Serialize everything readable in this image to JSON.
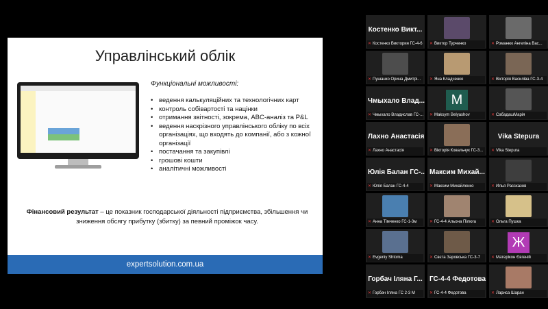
{
  "slide": {
    "title": "Управлінський облік",
    "subtitle": "Функціональні можливості:",
    "bullets": [
      "ведення калькуляційних та технологічних карт",
      "контроль собівартості та націнки",
      "отримання звітності, зокрема, ABC-аналіз та P&L",
      "ведення наскрізного управлінського обліку по всіх організаціях, що входять до компанії, або з кожної організації",
      "постачання та закупівлі",
      "грошові кошти",
      "аналітичні можливості"
    ],
    "financial_term": "Фінансовий результат",
    "financial_text": " – це показник господарської діяльності підприємства, збільшення чи зниження обсягу прибутку (збитку) за певний проміжок часу.",
    "footer": "expertsolution.com.ua"
  },
  "participants": [
    {
      "big_name": "Костенко Викт...",
      "label": "Костенко Виктория ГС-4-6",
      "avatar": null
    },
    {
      "big_name": "",
      "label": "Виктор Турченко",
      "avatar": {
        "type": "photo",
        "color": "#5b4a6a"
      }
    },
    {
      "big_name": "",
      "label": "Романюк Ангеліна Вас...",
      "avatar": {
        "type": "photo",
        "color": "#6a6a6a"
      }
    },
    {
      "big_name": "",
      "label": "Пушанко Орина Дмитрі...",
      "avatar": {
        "type": "photo",
        "color": "#4d4d4d"
      }
    },
    {
      "big_name": "",
      "label": "Яна Кладченко",
      "avatar": {
        "type": "photo",
        "color": "#b89a72"
      }
    },
    {
      "big_name": "",
      "label": "Вікторія Василіва ГС-3-4",
      "avatar": {
        "type": "photo",
        "color": "#7a6655"
      }
    },
    {
      "big_name": "Чмыхало Влад...",
      "label": "Чмыхало Владислав ГС-...",
      "avatar": null
    },
    {
      "big_name": "",
      "label": "Maksym Belyashov",
      "avatar": {
        "type": "letter",
        "letter": "M",
        "color": "#1f5c4f"
      }
    },
    {
      "big_name": "",
      "label": "СабадашМарія",
      "avatar": {
        "type": "photo",
        "color": "#555555"
      }
    },
    {
      "big_name": "Лахно Анастасія",
      "label": "Лахно Анастасія",
      "avatar": null
    },
    {
      "big_name": "",
      "label": "Вікторія Ковальчук ГС-3...",
      "avatar": {
        "type": "photo",
        "color": "#8a6e58"
      }
    },
    {
      "big_name": "Vika Stepura",
      "label": "Vika Stepura",
      "avatar": null
    },
    {
      "big_name": "Юлія Балан ГС-...",
      "label": "Юлія Балан ГС-4-4",
      "avatar": null
    },
    {
      "big_name": "Максим Михай...",
      "label": "Максим Михайленко",
      "avatar": null
    },
    {
      "big_name": "",
      "label": "Илья Рассказов",
      "avatar": {
        "type": "photo",
        "color": "#3e3e3e"
      }
    },
    {
      "big_name": "",
      "label": "Анна Тімченко ГС-1-3м",
      "avatar": {
        "type": "photo",
        "color": "#4a7fb0"
      }
    },
    {
      "big_name": "",
      "label": "ГС-4-4 Альона Пілюга",
      "avatar": {
        "type": "photo",
        "color": "#a08470"
      }
    },
    {
      "big_name": "",
      "label": "Ольга Пушка",
      "avatar": {
        "type": "photo",
        "color": "#d6c18a"
      }
    },
    {
      "big_name": "",
      "label": "Evgeniy Shtoma",
      "avatar": {
        "type": "photo",
        "color": "#5a7090"
      }
    },
    {
      "big_name": "",
      "label": "Свєта Заровська ГС-3-7",
      "avatar": {
        "type": "photo",
        "color": "#6e5a48"
      }
    },
    {
      "big_name": "",
      "label": "Матерікон Євгеній",
      "avatar": {
        "type": "letter",
        "letter": "Ж",
        "color": "#b23bb5"
      }
    },
    {
      "big_name": "Горбач Іляна Г...",
      "label": "Горбач Іляна ГС 2-3 М",
      "avatar": null
    },
    {
      "big_name": "ГС-4-4 Федотова",
      "label": "ГС-4-4 Федотова",
      "avatar": null
    },
    {
      "big_name": "",
      "label": "Лариса Шаран",
      "avatar": {
        "type": "photo",
        "color": "#a87a66"
      }
    }
  ],
  "colors": {
    "mic_muted": "#e03b3b",
    "slide_footer": "#2a6bb5",
    "tile_bg": "#1f1f1f"
  }
}
